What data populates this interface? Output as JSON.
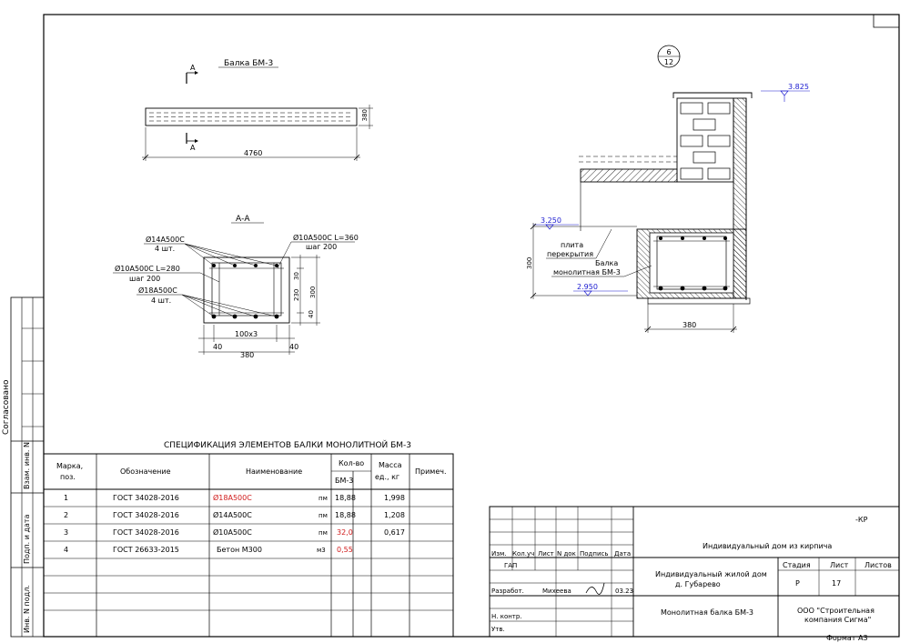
{
  "sheet": {
    "format": "Формат А3",
    "code_suffix": "-КР"
  },
  "left_strip": {
    "agreed": "Согласовано",
    "vzam": "Взам. инв. N",
    "podp": "Подп. и дата",
    "inv": "Инв. N подл."
  },
  "beam": {
    "title": "Балка БМ-3",
    "section_mark": "А",
    "length": "4760",
    "height": "380"
  },
  "section": {
    "title": "А-А",
    "label_top_bars": "Ø14А500С",
    "label_top_qty": "4 шт.",
    "label_stirrup_right": "Ø10А500С  L=360",
    "label_stirrup_right_step": "шаг 200",
    "label_stirrup_left": "Ø10А500С  L=280",
    "label_stirrup_left_step": "шаг 200",
    "label_bottom_bars": "Ø18А500С",
    "label_bottom_qty": "4 шт.",
    "dim_30": "30",
    "dim_230": "230",
    "dim_300": "300",
    "dim_40": "40",
    "dim_100x3": "100х3",
    "dim_40l": "40",
    "dim_40r": "40",
    "dim_380": "380"
  },
  "detail": {
    "circle_top": "6",
    "circle_bottom": "12",
    "level_top": "3.825",
    "level_mid": "3.250",
    "level_bot": "2.950",
    "slab_line1": "плита",
    "slab_line2": "перекрытия",
    "beam_line1": "Балка",
    "beam_line2": "монолитная БМ-3",
    "dim_300": "300",
    "dim_380": "380"
  },
  "spec": {
    "title": "СПЕЦИФИКАЦИЯ ЭЛЕМЕНТОВ БАЛКИ МОНОЛИТНОЙ БМ-3",
    "headers": {
      "mark": "Марка,",
      "pos": "поз.",
      "designation": "Обозначение",
      "name": "Наименование",
      "qty": "Кол-во",
      "qty_sub": "БМ-3",
      "mass": "Масса",
      "mass_sub": "ед., кг",
      "note": "Примеч."
    },
    "rows": [
      {
        "pos": "1",
        "designation": "ГОСТ 34028-2016",
        "name": "Ø18А500С",
        "unit": "пм",
        "qty": "18,88",
        "mass": "1,998"
      },
      {
        "pos": "2",
        "designation": "ГОСТ 34028-2016",
        "name": "Ø14А500С",
        "unit": "пм",
        "qty": "18,88",
        "mass": "1,208"
      },
      {
        "pos": "3",
        "designation": "ГОСТ 34028-2016",
        "name": "Ø10А500С",
        "unit": "пм",
        "qty": "32,0",
        "mass": "0,617"
      },
      {
        "pos": "4",
        "designation": "ГОСТ 26633-2015",
        "name": "Бетон М300",
        "unit": "м3",
        "qty": "0,55",
        "mass": ""
      }
    ]
  },
  "stamp": {
    "project_title": "Индивидуальный дом из кирпича",
    "object_line1": "Индивидуальный жилой дом",
    "object_line2": "д. Губарево",
    "sheet_name": "Монолитная балка БМ-3",
    "org_line1": "ООО \"Строительная",
    "org_line2": "компания Сигма\"",
    "col_izm": "Изм.",
    "col_koluch": "Кол.уч",
    "col_list": "Лист",
    "col_ndok": "N док",
    "col_podpis": "Подпись",
    "col_data": "Дата",
    "gap": "ГАП",
    "razrab": "Разработ.",
    "razrab_name": "Михеева",
    "razrab_date": "03.23",
    "nkontr": "Н. контр.",
    "utv": "Утв.",
    "stadia": "Стадия",
    "list": "Лист",
    "listov": "Листов",
    "stadia_val": "Р",
    "list_val": "17"
  }
}
